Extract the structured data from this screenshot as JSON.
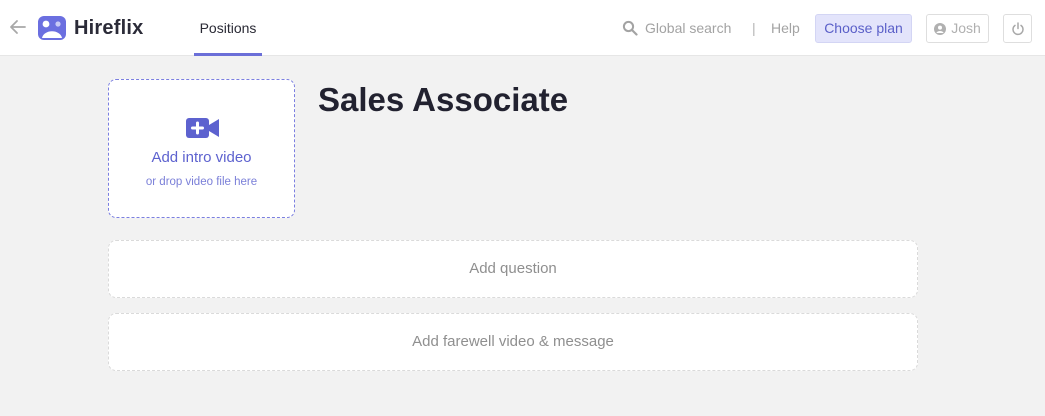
{
  "header": {
    "brand": "Hireflix",
    "nav_tab_label": "Positions",
    "search_label": "Global search",
    "divider": "|",
    "help_label": "Help",
    "choose_plan_label": "Choose plan",
    "user_name": "Josh",
    "icons": [
      "back-arrow-icon",
      "hireflix-logo-icon",
      "search-icon",
      "user-circle-icon",
      "power-icon"
    ]
  },
  "intro_video": {
    "title": "Add intro video",
    "subtitle": "or drop video file here",
    "icon": "video-camera-plus-icon"
  },
  "position": {
    "title": "Sales Associate"
  },
  "actions": {
    "add_question_label": "Add question",
    "add_farewell_label": "Add farewell video & message"
  },
  "colors": {
    "accent": "#5d62cf",
    "accent_light": "#e3e4fb",
    "background": "#f2f2f2",
    "muted_text": "#a3a3a3"
  }
}
